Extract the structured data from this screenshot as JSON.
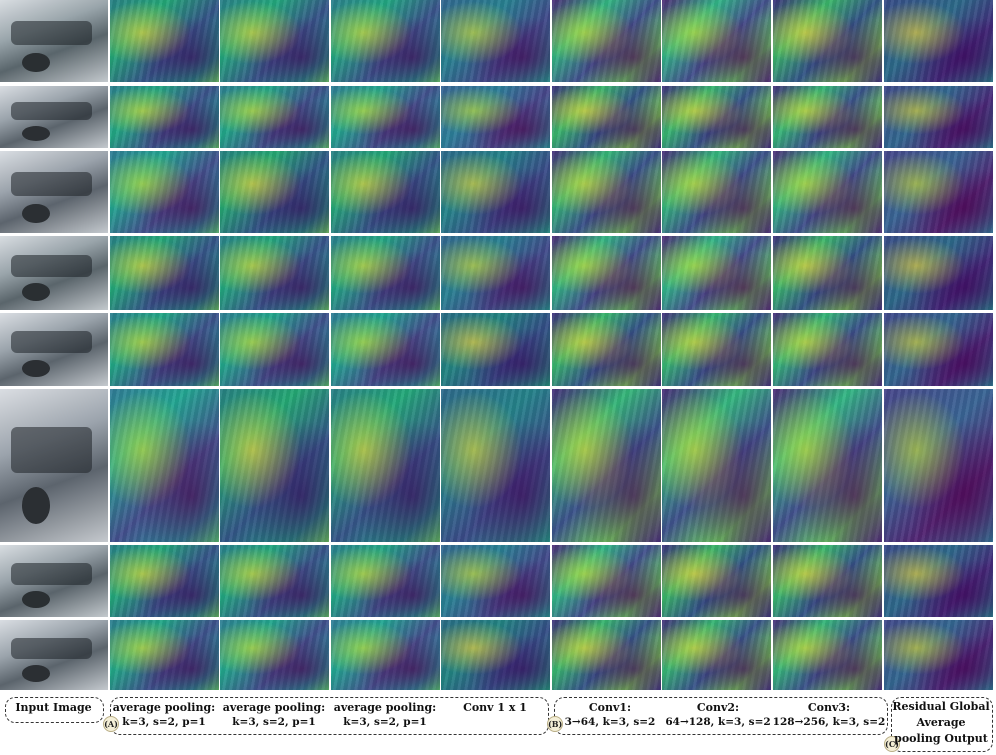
{
  "rows": 8,
  "columns": {
    "input": "Input Image",
    "group_a": {
      "marker": "(A)",
      "items": [
        {
          "title": "average pooling:",
          "params": "k=3, s=2, p=1"
        },
        {
          "title": "average pooling:",
          "params": "k=3, s=2, p=1"
        },
        {
          "title": "average pooling:",
          "params": "k=3, s=2, p=1"
        },
        {
          "title": "Conv 1 x 1",
          "params": ""
        }
      ]
    },
    "group_b": {
      "marker": "(B)",
      "items": [
        {
          "title": "Conv1:",
          "params": "3→64, k=3, s=2"
        },
        {
          "title": "Conv2:",
          "params": "64→128, k=3, s=2"
        },
        {
          "title": "Conv3:",
          "params": "128→256, k=3, s=2"
        }
      ]
    },
    "group_c": {
      "marker": "(C)",
      "lines": [
        "Residual Global",
        "Average",
        "pooling Output"
      ]
    }
  },
  "colors": {
    "feature_map_palette": [
      "#440154",
      "#3b528b",
      "#21918c",
      "#5ec962",
      "#fde725"
    ],
    "separator": "#ffffff",
    "caption_border": "#333333"
  }
}
